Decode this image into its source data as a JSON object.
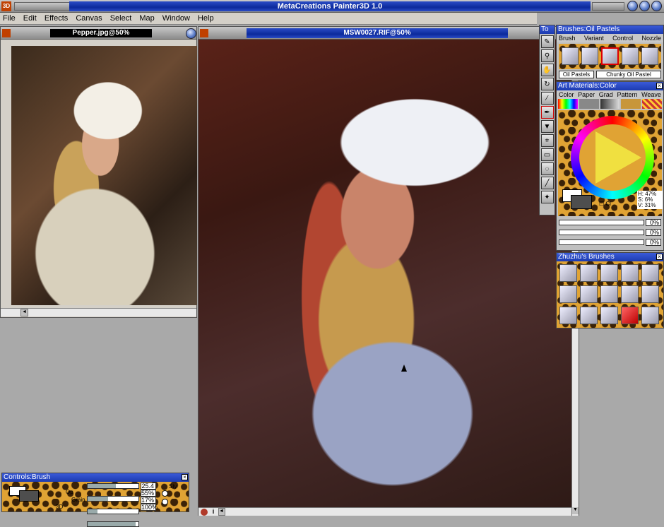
{
  "app": {
    "title": "MetaCreations Painter3D 1.0",
    "logo": "3D"
  },
  "menu": [
    "File",
    "Edit",
    "Effects",
    "Canvas",
    "Select",
    "Map",
    "Window",
    "Help"
  ],
  "doc_small": {
    "title": "Pepper.jpg@50%"
  },
  "doc_main": {
    "title": "MSW0027.RIF@50%"
  },
  "toolbox": {
    "title": "To",
    "tools": [
      "brush-icon",
      "magnifier-icon",
      "hand-icon",
      "rotate-icon",
      "dropper-icon",
      "pen-icon",
      "bucket-icon",
      "crop-icon",
      "rectangle-select-icon",
      "lasso-icon",
      "line-icon",
      "magic-wand-icon"
    ]
  },
  "brushes": {
    "title": "Brushes:Oil Pastels",
    "tabs": [
      "Brush",
      "Variant",
      "Control",
      "Nozzle"
    ],
    "category": "Oil Pastels",
    "variant": "Chunky Oil Pastel"
  },
  "art_materials": {
    "title": "Art Materials:Color",
    "tabs": [
      "Color",
      "Paper",
      "Grad",
      "Pattern",
      "Weave"
    ],
    "hsv": {
      "h": "H: 47%",
      "s": "S: 6%",
      "v": "V: 31%"
    },
    "clone_label": "Cl"
  },
  "sliders_pct": [
    "0%",
    "0%",
    "0%"
  ],
  "zhuzhu": {
    "title": "Zhuzhu's Brushes"
  },
  "controls": {
    "title": "Controls:Brush",
    "labels": [
      "Op",
      "Grain",
      "3D"
    ],
    "values": [
      "25.4",
      "55%",
      "17%",
      "100%"
    ],
    "style_label": "Sty"
  },
  "colors": {
    "accent": "#1c3bb0",
    "panel": "#c0c0c0",
    "leopard": "#e0a334"
  }
}
